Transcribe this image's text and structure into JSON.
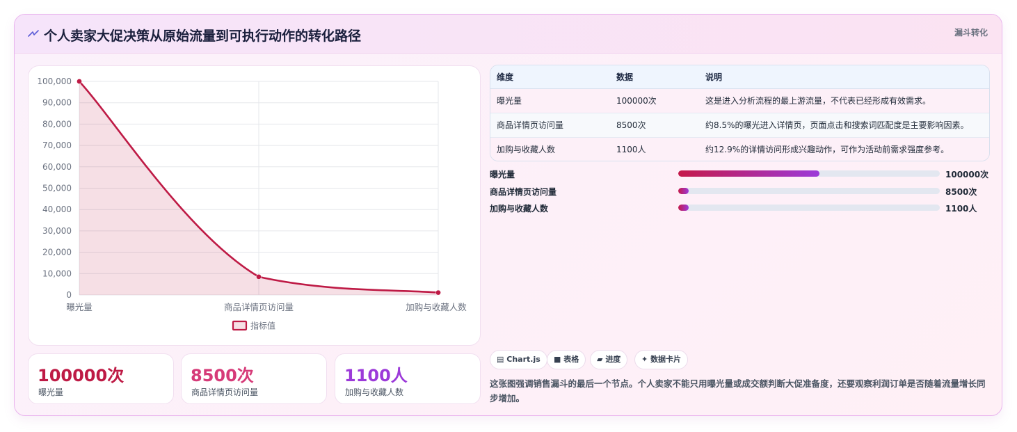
{
  "header": {
    "title": "个人卖家大促决策从原始流量到可执行动作的转化路径",
    "tag": "漏斗转化",
    "icon": "zigzag-icon"
  },
  "chart_data": {
    "type": "line",
    "categories": [
      "曝光量",
      "商品详情页访问量",
      "加购与收藏人数"
    ],
    "series": [
      {
        "name": "指标值",
        "values": [
          100000,
          8500,
          1100
        ]
      }
    ],
    "ylim": [
      0,
      100000
    ],
    "yticks": [
      "0",
      "10,000",
      "20,000",
      "30,000",
      "40,000",
      "50,000",
      "60,000",
      "70,000",
      "80,000",
      "90,000",
      "100,000"
    ],
    "area_fill": true,
    "grid": true,
    "legend": "bottom",
    "color": "#be1a45"
  },
  "kpis": [
    {
      "value": "100000次",
      "label": "曝光量",
      "color": "#be1a45"
    },
    {
      "value": "8500次",
      "label": "商品详情页访问量",
      "color": "#d63a78"
    },
    {
      "value": "1100人",
      "label": "加购与收藏人数",
      "color": "#9c3ad9"
    }
  ],
  "table": {
    "headers": [
      "维度",
      "数据",
      "说明"
    ],
    "rows": [
      [
        "曝光量",
        "100000次",
        "这是进入分析流程的最上游流量，不代表已经形成有效需求。"
      ],
      [
        "商品详情页访问量",
        "8500次",
        "约8.5%的曝光进入详情页，页面点击和搜索词匹配度是主要影响因素。"
      ],
      [
        "加购与收藏人数",
        "1100人",
        "约12.9%的详情访问形成兴趣动作，可作为活动前需求强度参考。"
      ]
    ]
  },
  "bars": [
    {
      "label": "曝光量",
      "value": "100000次",
      "fraction": 0.54
    },
    {
      "label": "商品详情页访问量",
      "value": "8500次",
      "fraction": 0.04
    },
    {
      "label": "加购与收藏人数",
      "value": "1100人",
      "fraction": 0.04
    }
  ],
  "chips": [
    {
      "icon": "chart-icon",
      "glyph": "▤",
      "label": "Chart.js"
    },
    {
      "icon": "table-icon",
      "glyph": "■",
      "label": "表格"
    },
    {
      "icon": "progress-icon",
      "glyph": "▰",
      "label": "进度"
    },
    {
      "icon": "sparkle-icon",
      "glyph": "✦",
      "label": "数据卡片"
    }
  ],
  "note": "这张图强调销售漏斗的最后一个节点。个人卖家不能只用曝光量或成交额判断大促准备度，还要观察利润订单是否随着流量增长同步增加。"
}
